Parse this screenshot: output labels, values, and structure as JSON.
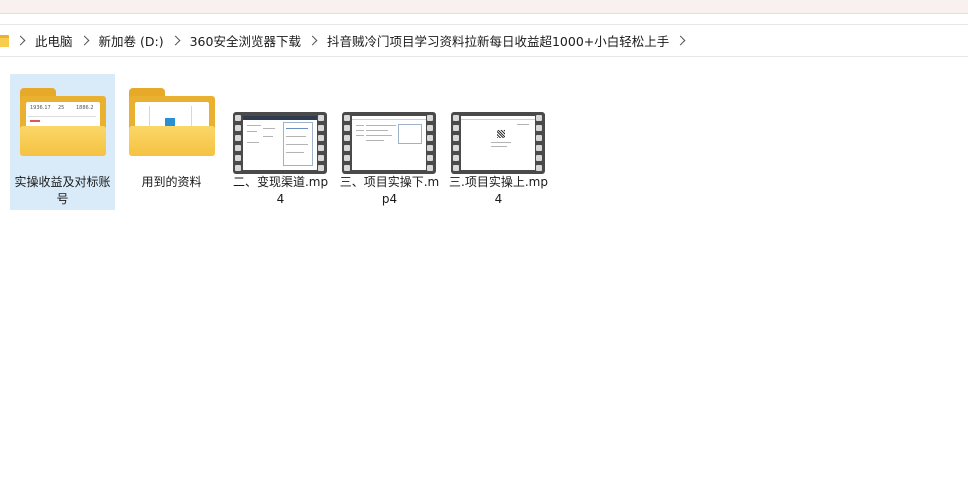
{
  "breadcrumb": {
    "items": [
      "此电脑",
      "新加卷 (D:)",
      "360安全浏览器下载",
      "抖音贼冷门项目学习资料拉新每日收益超1000+小白轻松上手"
    ]
  },
  "files": [
    {
      "type": "folder",
      "name": "实操收益及对标账号",
      "selected": true
    },
    {
      "type": "folder",
      "name": "用到的资料",
      "selected": false
    },
    {
      "type": "video",
      "name": "二、变现渠道.mp4",
      "selected": false
    },
    {
      "type": "video",
      "name": "三、项目实操下.mp4",
      "selected": false
    },
    {
      "type": "video",
      "name": "三.项目实操上.mp4",
      "selected": false
    }
  ],
  "folder_preview": {
    "stats": [
      "1936.17",
      "25",
      "1886.2"
    ]
  },
  "colors": {
    "selection": "#d9ebf9",
    "folder_front": "#f5c242",
    "folder_back": "#e9b12f"
  }
}
